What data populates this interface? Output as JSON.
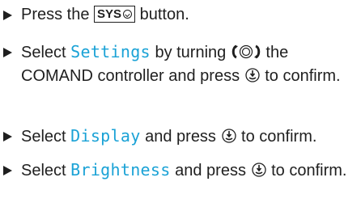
{
  "steps": [
    {
      "before": "Press the ",
      "key_label": "SYS",
      "after": " button."
    },
    {
      "before": "Select ",
      "keyword": "Settings",
      "middle": " by turning ",
      "middle2": " the COMAND controller and press ",
      "after": " to confirm."
    },
    {
      "before": "Select ",
      "keyword": "Display",
      "middle": " and press ",
      "after": " to confirm."
    },
    {
      "before": "Select ",
      "keyword": "Brightness",
      "middle": " and press ",
      "after": " to confirm."
    }
  ],
  "icons": {
    "bullet": "right-triangle-bullet",
    "key_symbol": "check-circle-icon",
    "turn": "controller-turn-icon",
    "press": "controller-press-icon"
  },
  "colors": {
    "text": "#1f1f1f",
    "keyword": "#1aa2d6"
  }
}
